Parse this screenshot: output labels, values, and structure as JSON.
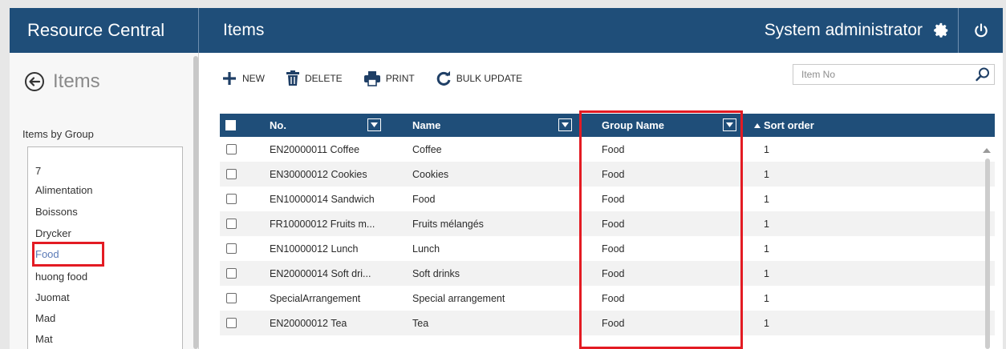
{
  "app": {
    "title": "Resource Central"
  },
  "header": {
    "page_title": "Items",
    "user": "System administrator"
  },
  "left": {
    "back_title": "Items",
    "group_caption": "Items by Group",
    "groups": [
      "7",
      "Alimentation",
      "Boissons",
      "Drycker",
      "Food",
      "huong food",
      "Juomat",
      "Mad",
      "Mat"
    ],
    "selected_group": "Food"
  },
  "toolbar": {
    "new": "NEW",
    "delete": "DELETE",
    "print": "PRINT",
    "bulk_update": "BULK UPDATE"
  },
  "search": {
    "placeholder": "Item No",
    "value": ""
  },
  "grid": {
    "columns": {
      "no": "No.",
      "name": "Name",
      "group": "Group Name",
      "sort": "Sort order"
    },
    "sort_column": "Sort order",
    "sort_direction": "ascending",
    "rows": [
      {
        "no": "EN20000011 Coffee",
        "name": "Coffee",
        "group": "Food",
        "sort": "1"
      },
      {
        "no": "EN30000012 Cookies",
        "name": "Cookies",
        "group": "Food",
        "sort": "1"
      },
      {
        "no": "EN10000014 Sandwich",
        "name": "Food",
        "group": "Food",
        "sort": "1"
      },
      {
        "no": "FR10000012 Fruits m...",
        "name": "Fruits mélangés",
        "group": "Food",
        "sort": "1"
      },
      {
        "no": "EN10000012 Lunch",
        "name": "Lunch",
        "group": "Food",
        "sort": "1"
      },
      {
        "no": "EN20000014 Soft dri...",
        "name": "Soft drinks",
        "group": "Food",
        "sort": "1"
      },
      {
        "no": "SpecialArrangement",
        "name": "Special arrangement",
        "group": "Food",
        "sort": "1"
      },
      {
        "no": "EN20000012 Tea",
        "name": "Tea",
        "group": "Food",
        "sort": "1"
      }
    ]
  },
  "colors": {
    "header_bg": "#1f4e79",
    "highlight": "#e31b23",
    "selected_text": "#5a7ab7"
  }
}
